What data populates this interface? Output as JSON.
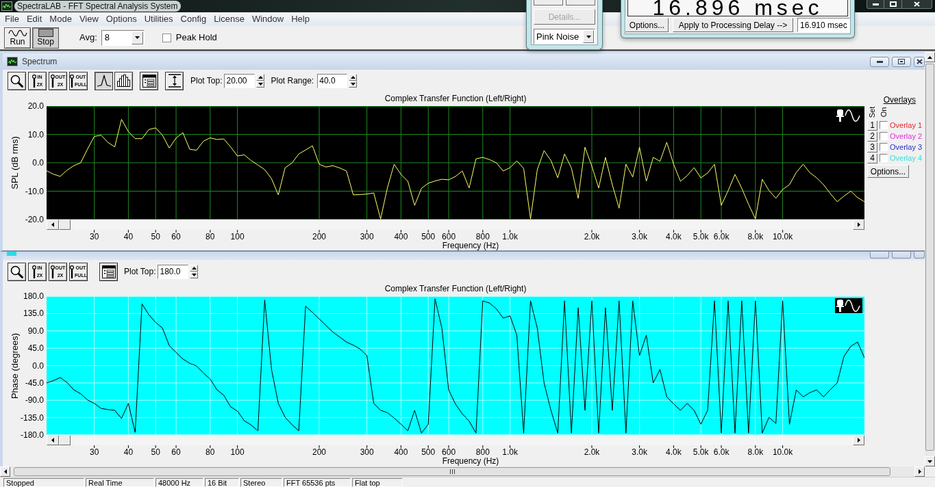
{
  "window": {
    "title": "SpectraLAB - FFT Spectral Analysis System"
  },
  "menu": [
    "File",
    "Edit",
    "Mode",
    "View",
    "Options",
    "Utilities",
    "Config",
    "License",
    "Window",
    "Help"
  ],
  "toolbar": {
    "buttons": [
      {
        "kind": "run",
        "label": "Run",
        "selected": false
      },
      {
        "kind": "stop",
        "label": "Stop",
        "selected": true
      }
    ],
    "avg": {
      "label": "Avg:",
      "value": "8"
    },
    "peak_hold": {
      "label": "Peak Hold",
      "checked": false
    }
  },
  "generator_panel": {
    "details_button": {
      "label": "Details...",
      "disabled": true
    },
    "noise_type": {
      "value": "Pink Noise"
    }
  },
  "delay_panel": {
    "reading": "16.896 msec",
    "options_button": "Options...",
    "apply_button": "Apply to Processing Delay -->",
    "delay_field": {
      "value": "16.910 msec"
    }
  },
  "spectrum": {
    "title": "Spectrum",
    "zoom_tools": [
      {
        "kind": "zoom"
      },
      {
        "kind": "zoom_in",
        "lines": [
          "IN",
          "2X"
        ]
      },
      {
        "kind": "zoom_out",
        "lines": [
          "OUT",
          "2X"
        ]
      },
      {
        "kind": "zoom_full",
        "lines": [
          "OUT",
          "FULL"
        ]
      }
    ],
    "plot_modes": [
      {
        "kind": "line",
        "selected": true
      },
      {
        "kind": "bars",
        "selected": false
      }
    ],
    "tools": [
      {
        "kind": "settings"
      },
      {
        "kind": "scale"
      }
    ],
    "fields": [
      {
        "label": "Plot Top:",
        "value": "20.00"
      },
      {
        "label": "Plot Range:",
        "value": "40.0"
      }
    ],
    "chart_data": {
      "type": "line",
      "title": "Complex Transfer Function (Left/Right)",
      "xlabel": "Frequency (Hz)",
      "ylabel": "SPL (dB rms)",
      "grid": true,
      "categories": [
        null,
        null,
        null,
        null,
        null,
        null,
        null,
        "30",
        null,
        null,
        null,
        null,
        "40",
        null,
        null,
        null,
        "50",
        null,
        null,
        "60",
        null,
        null,
        null,
        null,
        "80",
        null,
        null,
        null,
        "100",
        null,
        null,
        null,
        null,
        null,
        null,
        null,
        null,
        null,
        null,
        null,
        "200",
        null,
        null,
        null,
        null,
        null,
        null,
        "300",
        null,
        null,
        null,
        null,
        "400",
        null,
        null,
        null,
        "500",
        null,
        null,
        "600",
        null,
        null,
        null,
        null,
        "800",
        null,
        null,
        null,
        "1.0k",
        null,
        null,
        null,
        null,
        null,
        null,
        null,
        null,
        null,
        null,
        null,
        "2.0k",
        null,
        null,
        null,
        null,
        null,
        null,
        "3.0k",
        null,
        null,
        null,
        null,
        "4.0k",
        null,
        null,
        null,
        "5.0k",
        null,
        null,
        "6.0k",
        null,
        null,
        null,
        null,
        "8.0k",
        null,
        null,
        null,
        "10.0k",
        null,
        null,
        null,
        null,
        null,
        null,
        null,
        null,
        null,
        null,
        null,
        null
      ],
      "series": [
        {
          "color": "#ffff66",
          "values": [
            -2.8,
            -4.0,
            -4.8,
            -2.6,
            -1.0,
            0.0,
            4.8,
            9.3,
            9.7,
            7.2,
            5.6,
            15.3,
            11.0,
            8.5,
            8.5,
            11.7,
            12.3,
            9.7,
            5.2,
            8.7,
            10.6,
            4.8,
            4.4,
            7.6,
            8.8,
            8.2,
            8.4,
            5.6,
            2.4,
            2.8,
            0.8,
            -0.8,
            -2.4,
            -5.6,
            -11.3,
            -1.7,
            -0.1,
            3.1,
            4.5,
            6.0,
            -0.5,
            -1.5,
            -1.0,
            -1.8,
            -2.9,
            -11.3,
            -11.2,
            -11.0,
            -10.6,
            -19.8,
            -8.9,
            -0.5,
            -4.1,
            -6.5,
            -15.0,
            -9.0,
            -7.2,
            -6.4,
            -5.8,
            -6.0,
            -4.8,
            -2.9,
            -8.9,
            1.4,
            1.9,
            1.1,
            0.0,
            -2.9,
            -1.7,
            0.7,
            -2.0,
            -19.8,
            -2.4,
            4.3,
            0.8,
            -5.3,
            3.1,
            -1.8,
            -12.5,
            5.5,
            -1.2,
            -8.9,
            1.9,
            -7.7,
            -16.0,
            -0.5,
            -5.0,
            5.5,
            -6.5,
            1.9,
            0.5,
            7.2,
            -0.5,
            -6.5,
            -4.5,
            -1.7,
            -5.3,
            -3.6,
            -0.5,
            -15.0,
            -9.8,
            -4.1,
            -9.0,
            -14.6,
            -19.8,
            -5.8,
            -9.8,
            -12.5,
            -9.4,
            -7.7,
            -3.4,
            -0.5,
            -3.5,
            -5.3,
            -7.7,
            -10.9,
            -13.7,
            -11.7,
            -10.0,
            -12.3,
            -13.7
          ]
        }
      ],
      "ylim": [
        -20,
        20
      ],
      "yticks": [
        {
          "value": 20,
          "label": "20.0"
        },
        {
          "value": 10,
          "label": "10.0"
        },
        {
          "value": 0,
          "label": "0.0"
        },
        {
          "value": -10,
          "label": "-10.0"
        },
        {
          "value": -20,
          "label": "-20.0"
        }
      ]
    },
    "overlays": {
      "title": "Overlays",
      "set_label": "Set",
      "on_label": "On",
      "items": [
        {
          "set": "1",
          "label": "Overlay 1",
          "on": false,
          "color": "#e8262a"
        },
        {
          "set": "2",
          "label": "Overlay 2",
          "on": false,
          "color": "#e02ee0"
        },
        {
          "set": "3",
          "label": "Overlay 3",
          "on": false,
          "color": "#2b2bc8"
        },
        {
          "set": "4",
          "label": "Overlay 4",
          "on": false,
          "color": "#33e0e0"
        }
      ],
      "options_button": "Options..."
    }
  },
  "phase": {
    "zoom_tools": [
      {
        "kind": "zoom"
      },
      {
        "kind": "zoom_in",
        "lines": [
          "IN",
          "2X"
        ]
      },
      {
        "kind": "zoom_out",
        "lines": [
          "OUT",
          "2X"
        ]
      },
      {
        "kind": "zoom_full",
        "lines": [
          "OUT",
          "FULL"
        ]
      }
    ],
    "tools": [
      {
        "kind": "settings"
      }
    ],
    "fields": [
      {
        "label": "Plot Top:",
        "value": "180.0"
      }
    ],
    "chart_data": {
      "type": "line",
      "title": "Complex Transfer Function (Left/Right)",
      "xlabel": "Frequency (Hz)",
      "ylabel": "Phase (degrees)",
      "grid": true,
      "categories": [
        null,
        null,
        null,
        null,
        null,
        null,
        null,
        "30",
        null,
        null,
        null,
        null,
        "40",
        null,
        null,
        null,
        "50",
        null,
        null,
        "60",
        null,
        null,
        null,
        null,
        "80",
        null,
        null,
        null,
        "100",
        null,
        null,
        null,
        null,
        null,
        null,
        null,
        null,
        null,
        null,
        null,
        "200",
        null,
        null,
        null,
        null,
        null,
        null,
        "300",
        null,
        null,
        null,
        null,
        "400",
        null,
        null,
        null,
        "500",
        null,
        null,
        "600",
        null,
        null,
        null,
        null,
        "800",
        null,
        null,
        null,
        "1.0k",
        null,
        null,
        null,
        null,
        null,
        null,
        null,
        null,
        null,
        null,
        null,
        "2.0k",
        null,
        null,
        null,
        null,
        null,
        null,
        "3.0k",
        null,
        null,
        null,
        null,
        "4.0k",
        null,
        null,
        null,
        "5.0k",
        null,
        null,
        "6.0k",
        null,
        null,
        null,
        null,
        "8.0k",
        null,
        null,
        null,
        "10.0k",
        null,
        null,
        null,
        null,
        null,
        null,
        null,
        null,
        null,
        null,
        null,
        null
      ],
      "series": [
        {
          "color": "#000000",
          "values": [
            -45,
            -39,
            -31,
            -44,
            -63,
            -73,
            -89,
            -98,
            -111,
            -114,
            -116,
            -137,
            -98,
            -173,
            160,
            132,
            112,
            97,
            52,
            34,
            17,
            6,
            -1,
            -19,
            -35,
            -63,
            -77,
            -107,
            -118,
            -143,
            -154,
            -169,
            170,
            -10,
            -98,
            -134,
            -153,
            -169,
            154,
            138,
            121,
            104,
            87,
            74,
            61,
            53,
            43,
            26,
            -98,
            -116,
            -122,
            -136,
            -152,
            -169,
            -116,
            -175,
            -152,
            173,
            97,
            -63,
            -100,
            -125,
            -144,
            -175,
            168,
            162,
            147,
            123,
            129,
            79,
            -175,
            168,
            97,
            -45,
            -116,
            -175,
            168,
            -175,
            150,
            -116,
            168,
            -175,
            150,
            -116,
            168,
            -175,
            168,
            26,
            79,
            -45,
            -10,
            -81,
            -99,
            -116,
            -98,
            -116,
            -152,
            -116,
            168,
            -175,
            168,
            -175,
            168,
            -175,
            168,
            -175,
            -134,
            -150,
            168,
            -152,
            -63,
            -81,
            -70,
            -63,
            -81,
            -62,
            -45,
            24,
            50,
            61,
            20
          ]
        }
      ],
      "ylim": [
        -180,
        180
      ],
      "yticks": [
        {
          "value": 180,
          "label": "180.0"
        },
        {
          "value": 135,
          "label": "135.0"
        },
        {
          "value": 90,
          "label": "90.0"
        },
        {
          "value": 45,
          "label": "45.0"
        },
        {
          "value": 0,
          "label": "0.0"
        },
        {
          "value": -45,
          "label": "-45.0"
        },
        {
          "value": -90,
          "label": "-90.0"
        },
        {
          "value": -135,
          "label": "-135.0"
        },
        {
          "value": -180,
          "label": "-180.0"
        }
      ]
    }
  },
  "status_bar": [
    "Stopped",
    "Real Time",
    "48000 Hz",
    "16 Bit",
    "Stereo",
    "FFT 65536 pts",
    "Flat top"
  ]
}
